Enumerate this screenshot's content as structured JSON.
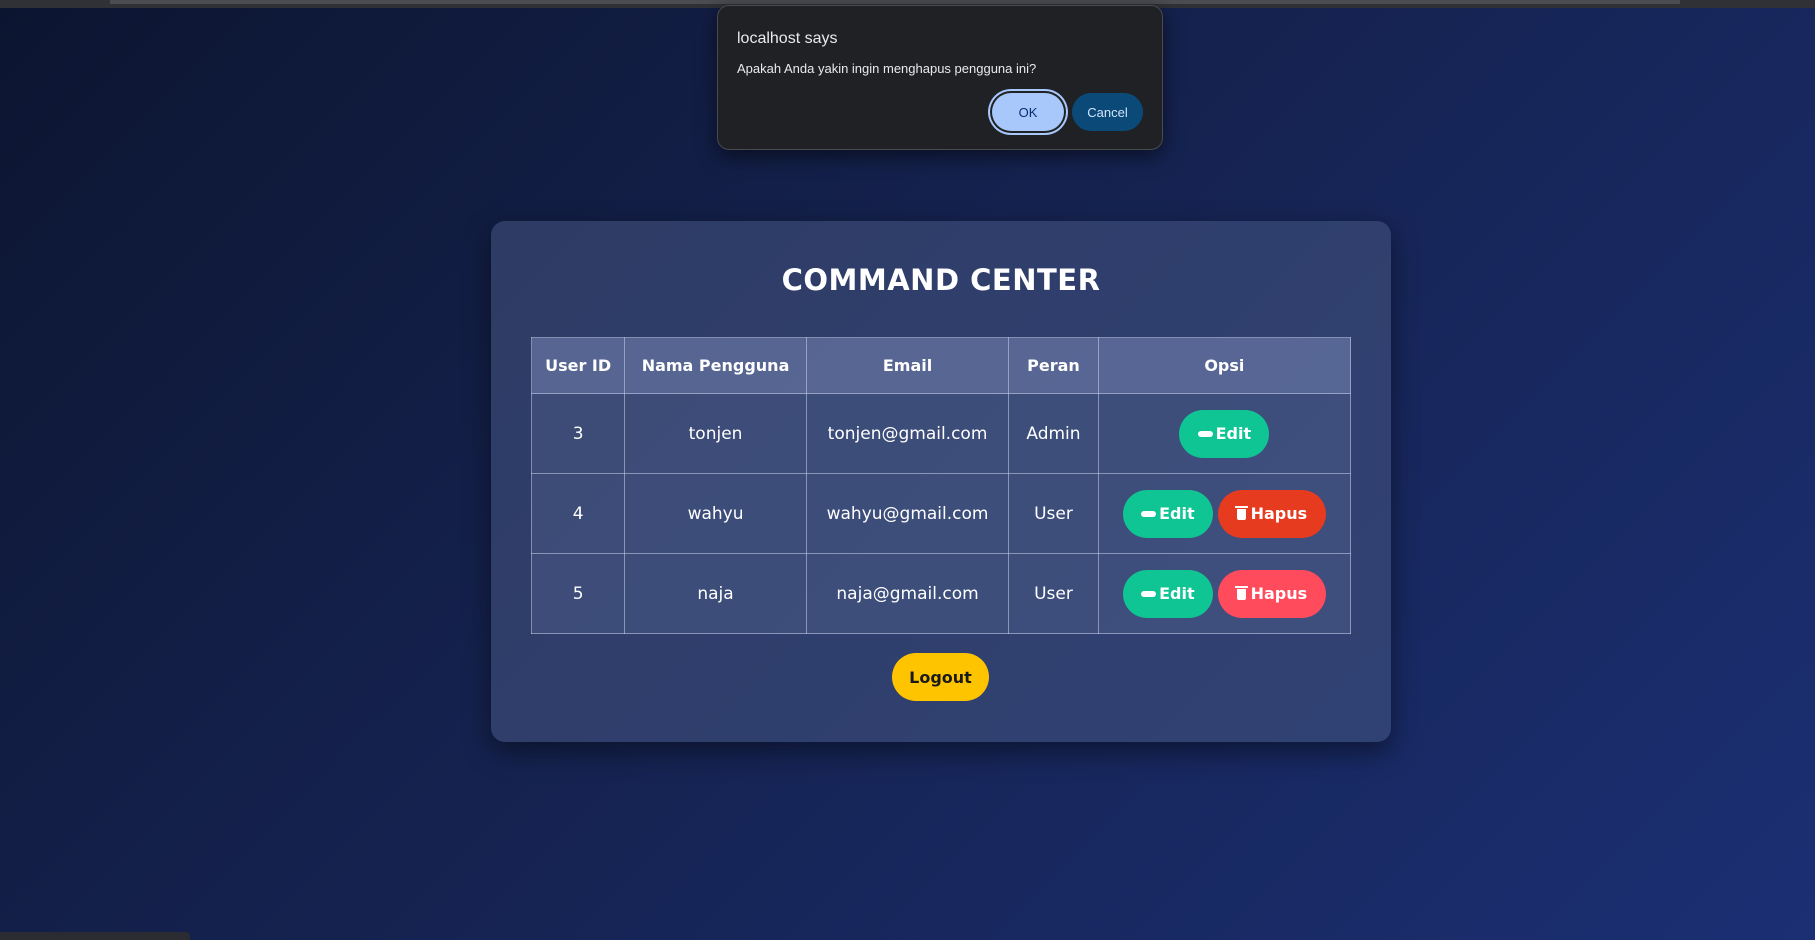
{
  "dialog": {
    "title": "localhost says",
    "message": "Apakah Anda yakin ingin menghapus pengguna ini?",
    "ok_label": "OK",
    "cancel_label": "Cancel"
  },
  "panel": {
    "title": "COMMAND CENTER",
    "columns": [
      "User ID",
      "Nama Pengguna",
      "Email",
      "Peran",
      "Opsi"
    ],
    "rows": [
      {
        "id": "3",
        "name": "tonjen",
        "email": "tonjen@gmail.com",
        "role": "Admin",
        "edit_label": "Edit"
      },
      {
        "id": "4",
        "name": "wahyu",
        "email": "wahyu@gmail.com",
        "role": "User",
        "edit_label": "Edit",
        "delete_label": "Hapus"
      },
      {
        "id": "5",
        "name": "naja",
        "email": "naja@gmail.com",
        "role": "User",
        "edit_label": "Edit",
        "delete_label": "Hapus"
      }
    ],
    "logout_label": "Logout"
  },
  "icons": {
    "edit": "pencil-icon",
    "delete": "trash-icon"
  },
  "colors": {
    "edit_button": "#10c594",
    "delete_button_hover": "#e63b1f",
    "delete_button": "#ff4b5c",
    "logout_button": "#ffc400",
    "dialog_ok": "#a8c7fa",
    "dialog_cancel": "#0b4a78"
  }
}
